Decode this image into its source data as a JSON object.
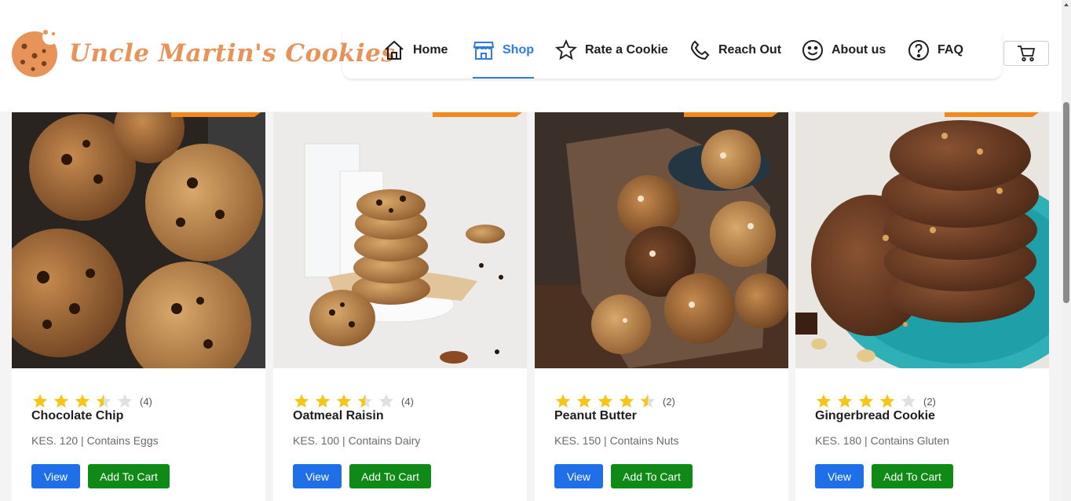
{
  "brand": {
    "name": "Uncle Martin's Cookies",
    "color": "#e8935a"
  },
  "nav": {
    "items": [
      {
        "label": "Home",
        "icon": "home-icon"
      },
      {
        "label": "Shop",
        "icon": "shop-icon",
        "active": true
      },
      {
        "label": "Rate a Cookie",
        "icon": "star-icon"
      },
      {
        "label": "Reach Out",
        "icon": "phone-icon"
      },
      {
        "label": "About us",
        "icon": "smiley-icon"
      },
      {
        "label": "FAQ",
        "icon": "question-icon"
      }
    ],
    "active_color": "#2f7be6",
    "cart_icon": "cart-icon"
  },
  "products": [
    {
      "name": "Chocolate Chip",
      "rating": 3.5,
      "reviews": "(4)",
      "meta": "KES. 120 | Contains Eggs",
      "view_label": "View",
      "cart_label": "Add To Cart"
    },
    {
      "name": "Oatmeal Raisin",
      "rating": 3.5,
      "reviews": "(4)",
      "meta": "KES. 100 | Contains Dairy",
      "view_label": "View",
      "cart_label": "Add To Cart"
    },
    {
      "name": "Peanut Butter",
      "rating": 4.5,
      "reviews": "(2)",
      "meta": "KES. 150 | Contains Nuts",
      "view_label": "View",
      "cart_label": "Add To Cart"
    },
    {
      "name": "Gingerbread Cookie",
      "rating": 4,
      "reviews": "(2)",
      "meta": "KES. 180 | Contains Gluten",
      "view_label": "View",
      "cart_label": "Add To Cart"
    }
  ],
  "colors": {
    "view_button": "#1f6fe8",
    "cart_button": "#0f8a16",
    "star_filled": "#f5c518",
    "star_empty": "#e0e0e0",
    "ribbon": "#f08a1c"
  }
}
